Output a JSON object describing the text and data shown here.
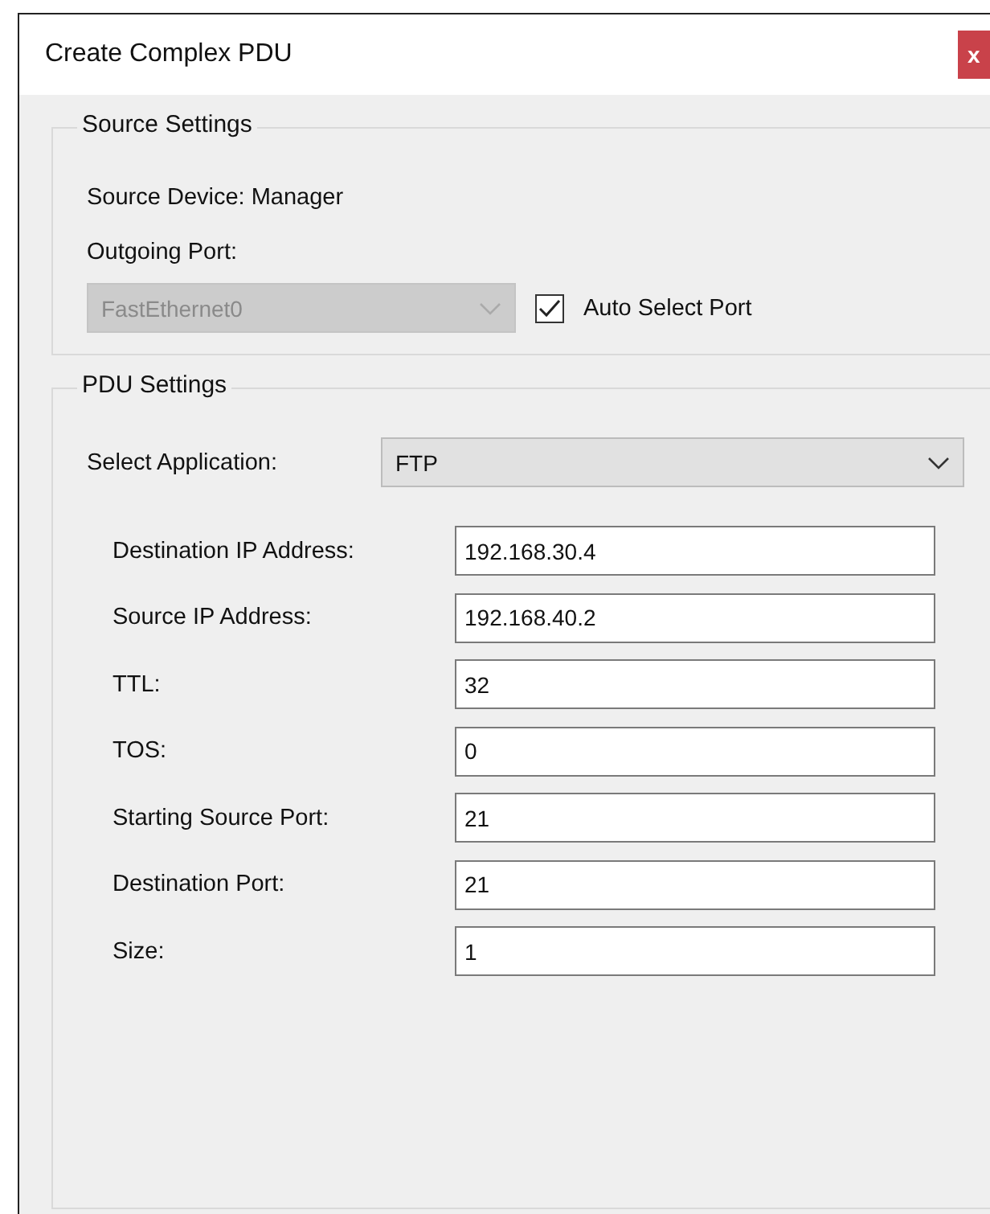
{
  "window": {
    "title": "Create Complex PDU",
    "close_button": "x"
  },
  "source_settings": {
    "title": "Source Settings",
    "source_device": "Source Device: Manager",
    "outgoing_port_label": "Outgoing Port:",
    "outgoing_port": {
      "value": "FastEthernet0",
      "disabled": true
    },
    "auto_select_port": {
      "label": "Auto Select Port",
      "checked": true
    }
  },
  "pdu_settings": {
    "title": "PDU Settings",
    "select_application": {
      "label": "Select Application:",
      "value": "FTP",
      "disabled": false
    },
    "fields": [
      {
        "label": "Destination IP Address:",
        "value": "192.168.30.4"
      },
      {
        "label": "Source IP Address:",
        "value": "192.168.40.2"
      },
      {
        "label": "TTL:",
        "value": "32"
      },
      {
        "label": "TOS:",
        "value": "0"
      },
      {
        "label": "Starting Source Port:",
        "value": "21"
      },
      {
        "label": "Destination Port:",
        "value": "21"
      },
      {
        "label": "Size:",
        "value": "1"
      }
    ]
  }
}
